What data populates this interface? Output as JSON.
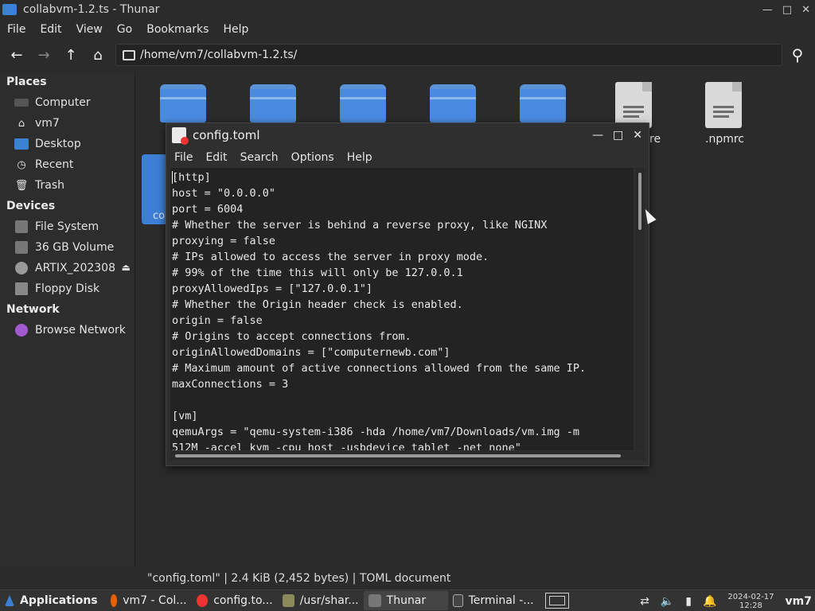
{
  "window": {
    "title": "collabvm-1.2.ts - Thunar"
  },
  "menu": [
    "File",
    "Edit",
    "View",
    "Go",
    "Bookmarks",
    "Help"
  ],
  "toolbar": {
    "path": "/home/vm7/collabvm-1.2.ts/"
  },
  "sidebar": {
    "places_heading": "Places",
    "places": [
      "Computer",
      "vm7",
      "Desktop",
      "Recent",
      "Trash"
    ],
    "devices_heading": "Devices",
    "devices": [
      "File System",
      "36 GB Volume",
      "ARTIX_202308",
      "Floppy Disk"
    ],
    "network_heading": "Network",
    "network": [
      "Browse Network"
    ]
  },
  "files": {
    "visible_labels": [
      "re",
      ".npmrc"
    ],
    "selected_partial_label": "co"
  },
  "status": {
    "text": "\"config.toml\"  |  2.4 KiB (2,452 bytes)  |  TOML document"
  },
  "editor": {
    "title": "config.toml",
    "menu": [
      "File",
      "Edit",
      "Search",
      "Options",
      "Help"
    ],
    "lines": [
      "[http]",
      "host = \"0.0.0.0\"",
      "port = 6004",
      "# Whether the server is behind a reverse proxy, like NGINX",
      "proxying = false",
      "# IPs allowed to access the server in proxy mode.",
      "# 99% of the time this will only be 127.0.0.1",
      "proxyAllowedIps = [\"127.0.0.1\"]",
      "# Whether the Origin header check is enabled.",
      "origin = false",
      "# Origins to accept connections from.",
      "originAllowedDomains = [\"computernewb.com\"]",
      "# Maximum amount of active connections allowed from the same IP.",
      "maxConnections = 3",
      "",
      "[vm]",
      "qemuArgs = \"qemu-system-i386 -hda /home/vm7/Downloads/vm.img -m",
      "512M -accel kvm -cpu host -usbdevice tablet -net none\""
    ]
  },
  "taskbar": {
    "applications": "Applications",
    "tasks": [
      "vm7 - Col...",
      "config.to...",
      "/usr/shar...",
      "Thunar",
      "Terminal -..."
    ],
    "clock_date": "2024-02-17",
    "clock_time": "12:28",
    "user": "vm7"
  }
}
